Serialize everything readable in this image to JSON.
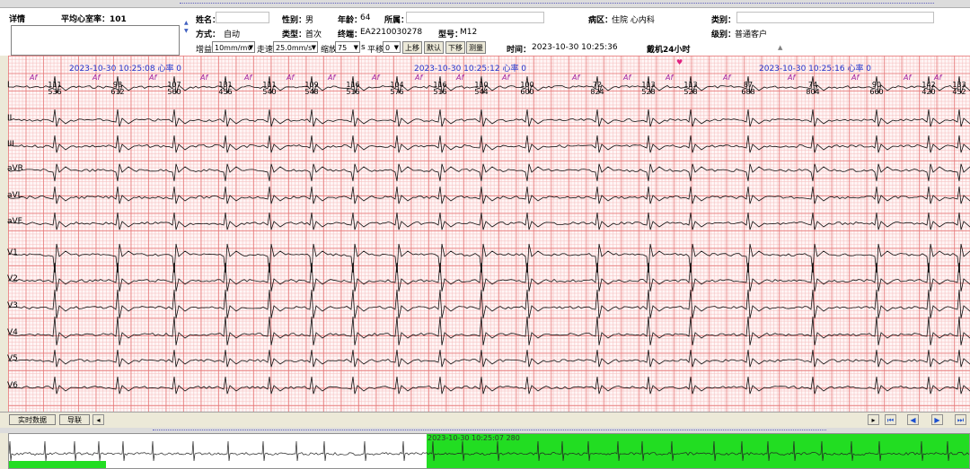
{
  "header": {
    "detail_label": "详情",
    "avg_hr_label": "平均心室率：",
    "avg_hr_value": "101",
    "name_label": "姓名：",
    "name_value": "",
    "gender_label": "性别：",
    "gender_value": "男",
    "age_label": "年龄：",
    "age_value": "64",
    "affiliation_label": "所属：",
    "affiliation_value": "",
    "ward_label": "病区：",
    "ward_value": "住院  心内科",
    "category_label": "类别：",
    "category_value": "",
    "mode_label": "方式：",
    "mode_value": "自动",
    "type_label": "类型：",
    "type_value": "首次",
    "terminal_label": "终端：",
    "terminal_value": "EA2210030278",
    "model_label": "型号：",
    "model_value": "M12",
    "level_label": "级别：",
    "level_value": "普通客户",
    "time_label": "时间：",
    "time_value": "2023-10-30 10:25:36",
    "device_note": "戴机24小时"
  },
  "controls": {
    "gain_label": "增益",
    "gain_value": "10mm/mv",
    "speed_label": "走速",
    "speed_value": "25.0mm/s",
    "scale_label": "缩放",
    "scale_value": "75",
    "scale_unit": "s",
    "shift_label": "平移",
    "shift_value": "0",
    "up_label": "上移",
    "default_label": "默认",
    "down_label": "下移",
    "measure_label": "测量"
  },
  "ecg": {
    "leads": [
      "I",
      "II",
      "III",
      "aVR",
      "aVL",
      "aVF",
      "V1",
      "V2",
      "V3",
      "V4",
      "V5",
      "V6"
    ],
    "timestamps": [
      "2023-10-30 10:25:08  心率 0",
      "2023-10-30 10:25:12  心率 0",
      "2023-10-30 10:25:16  心率 0"
    ],
    "beat_marker": "Af",
    "heart_rates": [
      "111",
      "98",
      "107",
      "131",
      "111",
      "109",
      "116",
      "104",
      "116",
      "110",
      "100",
      "72",
      "113",
      "113",
      "87",
      "74",
      "90",
      "142",
      "133"
    ],
    "rr_intervals": [
      "536",
      "612",
      "560",
      "456",
      "540",
      "548",
      "516",
      "576",
      "516",
      "544",
      "600",
      "824",
      "528",
      "528",
      "688",
      "804",
      "660",
      "420",
      "452"
    ]
  },
  "footer": {
    "realtime_tab": "实时数据",
    "lead_tab": "导联",
    "overview_timestamp": "2023-10-30  10:25:07  280"
  },
  "colors": {
    "grid_major": "#e67878",
    "grid_minor": "#f5bebe",
    "timestamp": "#2233cc",
    "af_marker": "#a020a0",
    "overview_highlight": "#22dd22",
    "nav_icon": "#1a4fd0"
  }
}
